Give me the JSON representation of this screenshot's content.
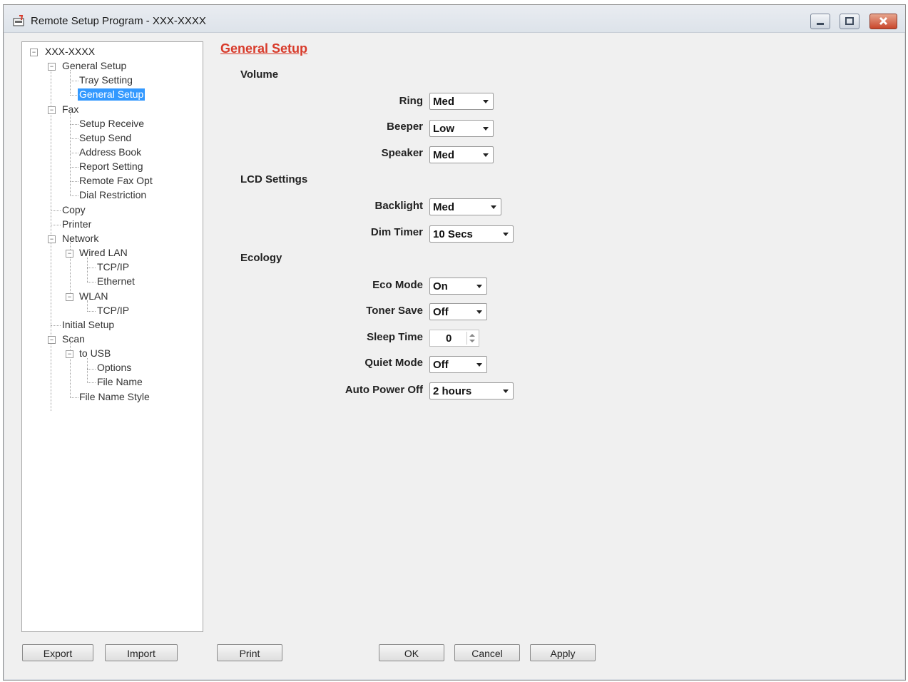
{
  "window": {
    "title": "Remote Setup Program - XXX-XXXX",
    "controls": {
      "minimize": "minimize",
      "maximize": "maximize",
      "close": "close"
    }
  },
  "tree": {
    "root": "XXX-XXXX",
    "items": [
      "General Setup",
      "Tray Setting",
      "General Setup",
      "Fax",
      "Setup Receive",
      "Setup Send",
      "Address Book",
      "Report Setting",
      "Remote Fax Opt",
      "Dial Restriction",
      "Copy",
      "Printer",
      "Network",
      "Wired LAN",
      "TCP/IP",
      "Ethernet",
      "WLAN",
      "TCP/IP",
      "Initial Setup",
      "Scan",
      "to USB",
      "Options",
      "File Name",
      "File Name Style"
    ],
    "selected": "General Setup"
  },
  "panel": {
    "title": "General Setup",
    "sections": {
      "volume": "Volume",
      "lcd": "LCD Settings",
      "ecology": "Ecology"
    },
    "fields": {
      "ring": {
        "label": "Ring",
        "value": "Med"
      },
      "beeper": {
        "label": "Beeper",
        "value": "Low"
      },
      "speaker": {
        "label": "Speaker",
        "value": "Med"
      },
      "backlight": {
        "label": "Backlight",
        "value": "Med"
      },
      "dim_timer": {
        "label": "Dim Timer",
        "value": "10 Secs"
      },
      "eco_mode": {
        "label": "Eco Mode",
        "value": "On"
      },
      "toner_save": {
        "label": "Toner Save",
        "value": "Off"
      },
      "sleep_time": {
        "label": "Sleep Time",
        "value": "0"
      },
      "quiet_mode": {
        "label": "Quiet Mode",
        "value": "Off"
      },
      "auto_power_off": {
        "label": "Auto Power Off",
        "value": "2 hours"
      }
    }
  },
  "buttons": {
    "export": "Export",
    "import": "Import",
    "print": "Print",
    "ok": "OK",
    "cancel": "Cancel",
    "apply": "Apply"
  },
  "colors": {
    "title_accent": "#d83a2a",
    "selection": "#3399ff",
    "close_button": "#c9462b"
  }
}
